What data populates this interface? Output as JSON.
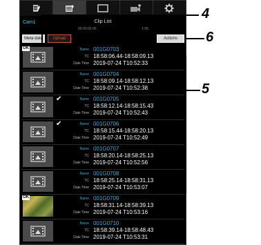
{
  "tabs": [
    {
      "icon": "pencil-icon"
    },
    {
      "icon": "clip-list-icon",
      "active": true
    },
    {
      "icon": "monitor-icon"
    },
    {
      "icon": "camera-settings-icon"
    },
    {
      "icon": "gear-icon"
    }
  ],
  "header": {
    "camera": "Cam1",
    "title": "Clip List",
    "tc_readout_1": "00:00:00:00",
    "tc_readout_2": "1:36"
  },
  "toolbar": {
    "meta_data_label": "Meta data",
    "upload_label": "Upload",
    "actions_label": "Actions"
  },
  "labels": {
    "name": "Name",
    "tc": "TC",
    "date_time": "Date Time"
  },
  "clips": [
    {
      "name": "001G0703",
      "tc": "18:58:06.44-18:58:09.13",
      "date_time": "2019-07-24 T10:52:33",
      "ok": true,
      "checked": false,
      "photo": false
    },
    {
      "name": "001G0704",
      "tc": "18:58:09.14-18:58:12.13",
      "date_time": "2019-07-24 T10:52:38",
      "ok": false,
      "checked": false,
      "photo": false
    },
    {
      "name": "001G0705",
      "tc": "18:58:12.14-18:58:15.43",
      "date_time": "2019-07-24 T10:52:43",
      "ok": false,
      "checked": true,
      "photo": false
    },
    {
      "name": "001G0706",
      "tc": "18:58:15.44-18:58:20.13",
      "date_time": "2019-07-24 T10:52:49",
      "ok": false,
      "checked": true,
      "photo": false
    },
    {
      "name": "001G0707",
      "tc": "18:58:20.14-18:58:25.13",
      "date_time": "2019-07-24 T10:52:56",
      "ok": false,
      "checked": false,
      "photo": false
    },
    {
      "name": "001G0708",
      "tc": "18:58:25.14-18:58:31.13",
      "date_time": "2019-07-24 T10:53:07",
      "ok": false,
      "checked": false,
      "photo": false
    },
    {
      "name": "001G0709",
      "tc": "18:58:31.14-18:58:39.13",
      "date_time": "2019-07-24 T10:53:16",
      "ok": true,
      "checked": false,
      "photo": true
    },
    {
      "name": "001G0710",
      "tc": "18:58:39.14-18:58:48.43",
      "date_time": "2019-07-24 T10:53:31",
      "ok": false,
      "checked": false,
      "photo": false
    }
  ],
  "ok_badge": "OK",
  "check_mark": "✔",
  "callouts": {
    "four": "4",
    "five": "5",
    "six": "6"
  }
}
